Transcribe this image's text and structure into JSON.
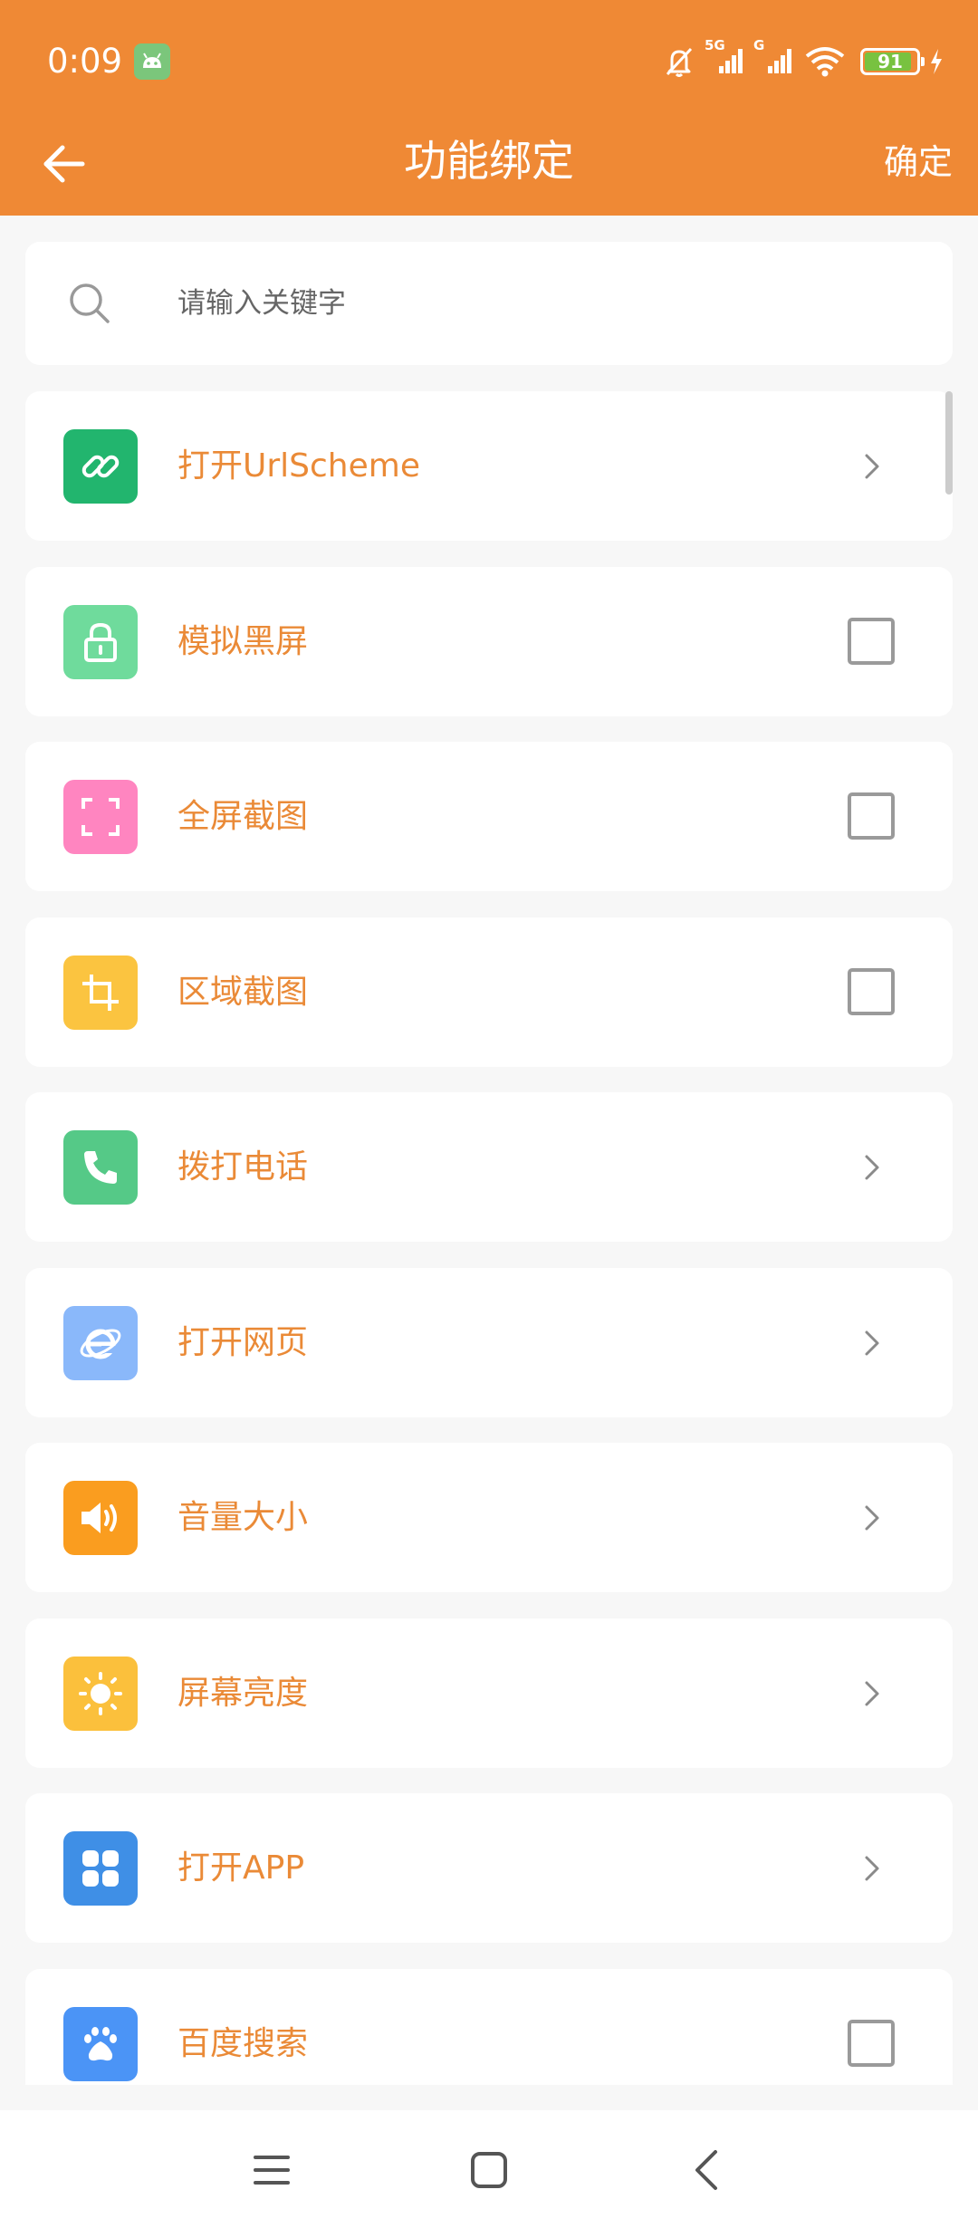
{
  "status_bar": {
    "time": "0:09",
    "network_1": "5G",
    "network_2": "G",
    "battery_level": "91",
    "battery_percent": 91,
    "icons": [
      "android-icon",
      "mute-icon",
      "signal-icon",
      "signal-icon",
      "wifi-icon",
      "battery-icon",
      "charging-icon"
    ]
  },
  "app_bar": {
    "title": "功能绑定",
    "confirm_label": "确定",
    "back_icon": "arrow-left-icon"
  },
  "search": {
    "placeholder": "请输入关键字",
    "value": "",
    "icon": "search-icon"
  },
  "colors": {
    "accent": "#ef8935",
    "label": "#ea8a37",
    "background": "#f7f7f7"
  },
  "items": [
    {
      "label": "打开UrlScheme",
      "icon": "link-icon",
      "icon_color": "#22b56e",
      "control": "chevron"
    },
    {
      "label": "模拟黑屏",
      "icon": "lock-icon",
      "icon_color": "#6fdb9c",
      "control": "checkbox",
      "checked": false
    },
    {
      "label": "全屏截图",
      "icon": "fullscreen-icon",
      "icon_color": "#ff85c0",
      "control": "checkbox",
      "checked": false
    },
    {
      "label": "区域截图",
      "icon": "crop-icon",
      "icon_color": "#fbc440",
      "control": "checkbox",
      "checked": false
    },
    {
      "label": "拨打电话",
      "icon": "phone-icon",
      "icon_color": "#55c987",
      "control": "chevron"
    },
    {
      "label": "打开网页",
      "icon": "browser-icon",
      "icon_color": "#8ab8fa",
      "control": "chevron"
    },
    {
      "label": "音量大小",
      "icon": "speaker-icon",
      "icon_color": "#fa9d1f",
      "control": "chevron"
    },
    {
      "label": "屏幕亮度",
      "icon": "brightness-icon",
      "icon_color": "#fbc03c",
      "control": "chevron"
    },
    {
      "label": "打开APP",
      "icon": "apps-icon",
      "icon_color": "#3f8fe6",
      "control": "chevron"
    },
    {
      "label": "百度搜索",
      "icon": "baidu-icon",
      "icon_color": "#4b94f6",
      "control": "checkbox",
      "checked": false
    }
  ],
  "nav_bar": {
    "icons": [
      "menu-icon",
      "home-icon",
      "back-icon"
    ]
  }
}
